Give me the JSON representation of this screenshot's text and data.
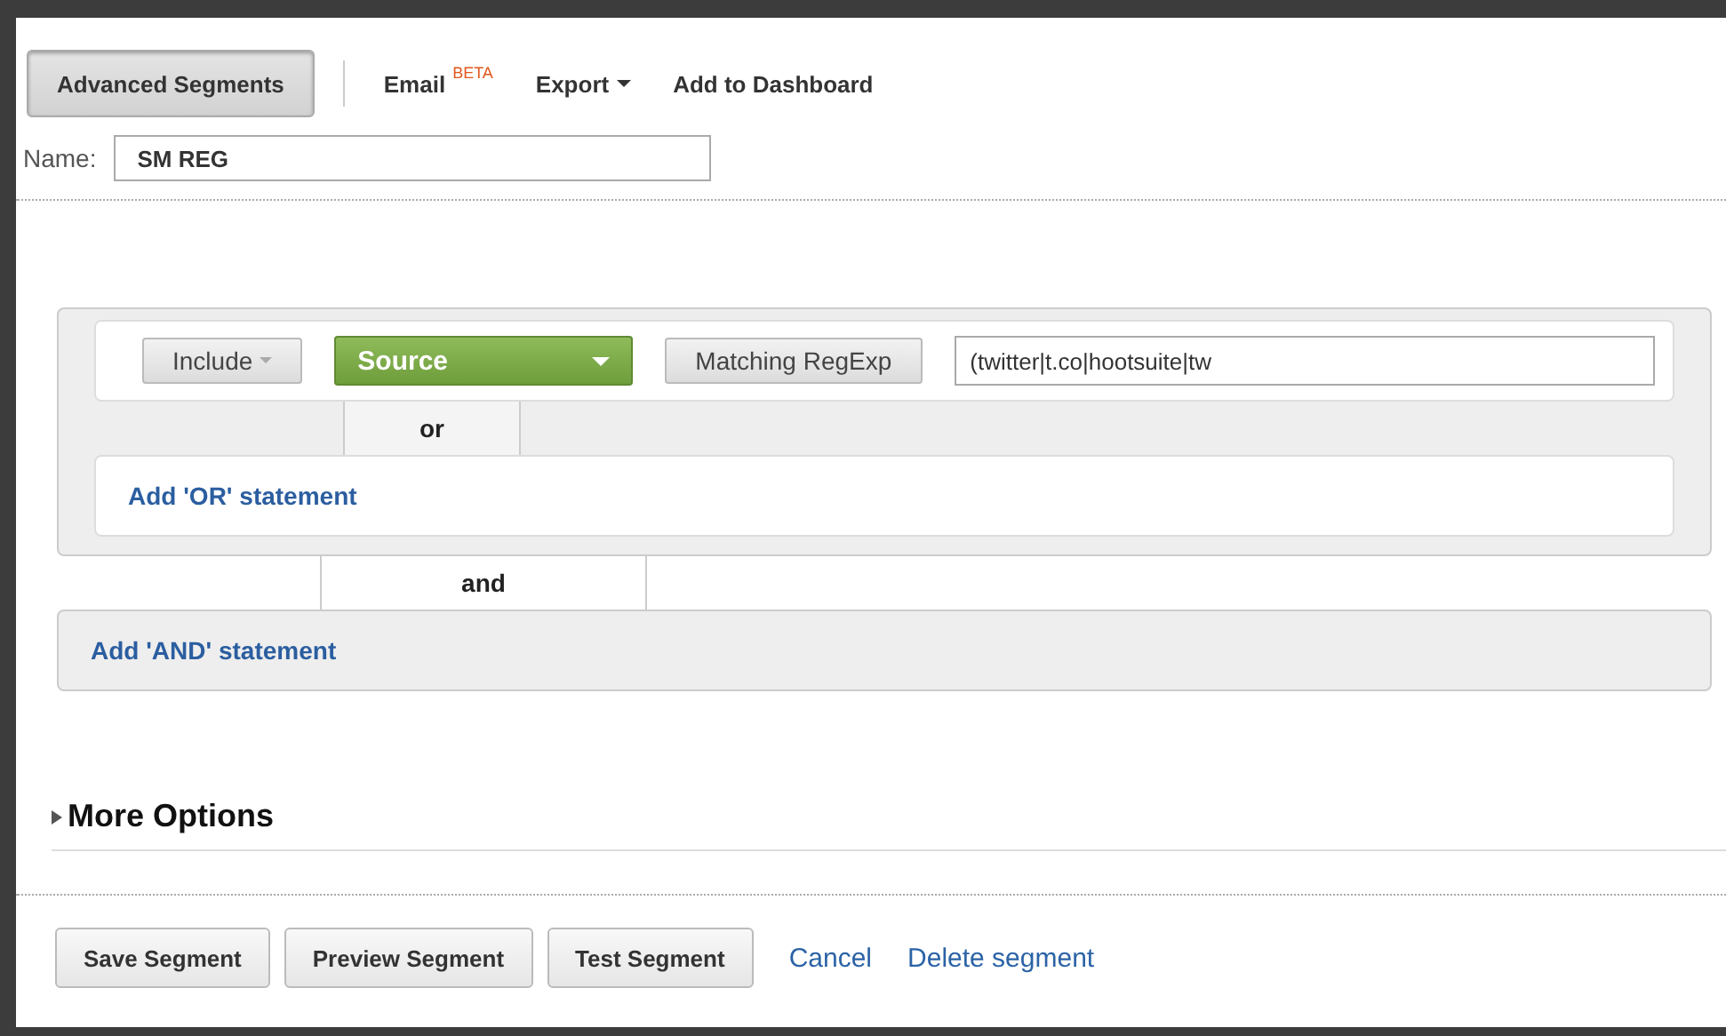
{
  "toolbar": {
    "segments_button": {
      "label": "Advanced Segments"
    },
    "items": [
      {
        "kind": "badge",
        "label": "Email",
        "badge": "BETA"
      },
      {
        "kind": "dropdown",
        "label": "Export"
      },
      {
        "kind": "plain",
        "label": "Add to Dashboard"
      }
    ]
  },
  "name_field": {
    "label": "Name:",
    "value": "SM REG"
  },
  "condition_group": {
    "rows": [
      {
        "include": "Include",
        "dimension": "Source",
        "match": "Matching RegExp",
        "value": "(twitter|t.co|hootsuite|tw"
      }
    ],
    "or_label": "or",
    "add_or": "Add 'OR' statement"
  },
  "and_label": "and",
  "add_and": "Add 'AND' statement",
  "more_options": {
    "label": "More Options",
    "expanded": false
  },
  "actions": {
    "buttons": [
      "Save Segment",
      "Preview Segment",
      "Test Segment"
    ],
    "links": [
      "Cancel",
      "Delete segment"
    ]
  }
}
